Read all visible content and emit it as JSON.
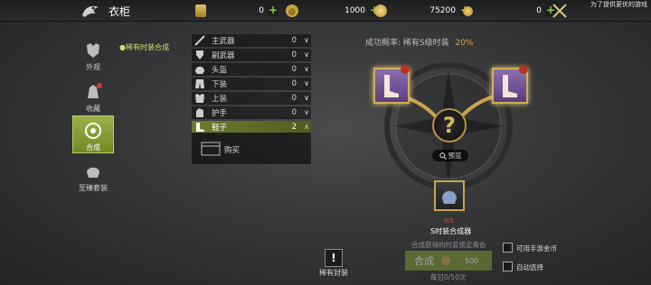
{
  "topbar": {
    "title": "衣柜",
    "notice": "为了提供更优的游戏",
    "resources": [
      {
        "icon": "scroll-icon",
        "value": "0"
      },
      {
        "icon": "swirl-coin-icon",
        "value": "1000"
      },
      {
        "icon": "gold-bag-icon",
        "value": "75200"
      },
      {
        "icon": "gold-coin-icon",
        "value": "0"
      }
    ]
  },
  "sidebar": {
    "items": [
      {
        "label": "外观"
      },
      {
        "label": "收藏"
      },
      {
        "label": "合成"
      },
      {
        "label": "至臻套装"
      }
    ]
  },
  "submenu": {
    "label": "●稀有时装合成"
  },
  "categories": [
    {
      "label": "主武器",
      "count": "0",
      "arrow": "∨"
    },
    {
      "label": "副武器",
      "count": "0",
      "arrow": "∨"
    },
    {
      "label": "头盔",
      "count": "0",
      "arrow": "∨"
    },
    {
      "label": "下装",
      "count": "0",
      "arrow": "∨"
    },
    {
      "label": "上装",
      "count": "0",
      "arrow": "∨"
    },
    {
      "label": "护手",
      "count": "0",
      "arrow": "∨"
    },
    {
      "label": "鞋子",
      "count": "2",
      "arrow": "∧"
    }
  ],
  "buy": {
    "label": "购买"
  },
  "synthesis": {
    "success_label": "成功概率: 稀有S级时装",
    "success_rate": "20%",
    "preview_label": "预览",
    "material_count": "0/1",
    "material_name": "S时装合成器",
    "hint": "合成获得的时装锁定角色",
    "button_label": "合成",
    "cost": "500",
    "daily": "每日0/50次"
  },
  "options": {
    "use_gold": "可用手游金币",
    "auto_select": "自动选择"
  },
  "rare_seal": {
    "label": "稀有封装"
  },
  "colors": {
    "accent": "#9bb24a",
    "gold": "#d9b55a",
    "rate": "#e0a64a"
  }
}
